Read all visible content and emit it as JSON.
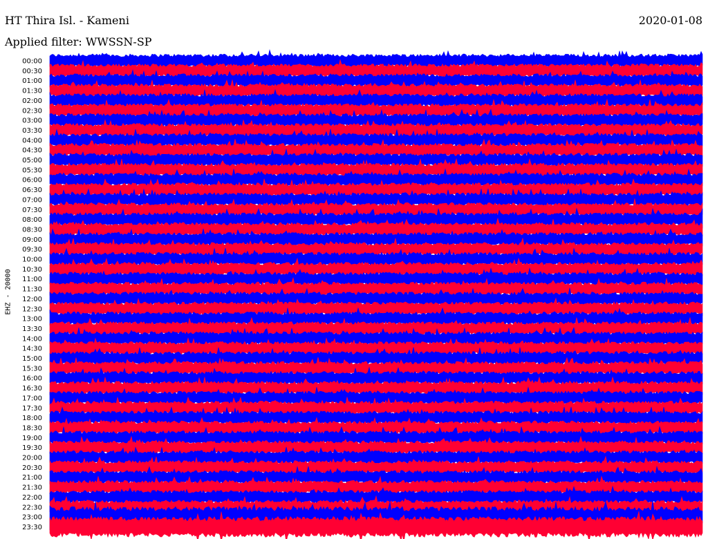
{
  "header": {
    "station": "HT Thira Isl. - Kameni",
    "date": "2020-01-08",
    "filter": "Applied filter: WWSSN-SP"
  },
  "channel_label": "EHZ - 20000",
  "colors": {
    "even_trace": "#0000ff",
    "odd_trace": "#ff0033",
    "background": "#ffffff"
  },
  "chart_data": {
    "type": "line",
    "title": "HT Thira Isl. - Kameni",
    "subtitle": "Applied filter: WWSSN-SP",
    "date": "2020-01-08",
    "ylabel": "EHZ - 20000",
    "y_tick_labels": [
      "00:00",
      "00:30",
      "01:00",
      "01:30",
      "02:00",
      "02:30",
      "03:00",
      "03:30",
      "04:00",
      "04:30",
      "05:00",
      "05:30",
      "06:00",
      "06:30",
      "07:00",
      "07:30",
      "08:00",
      "08:30",
      "09:00",
      "09:30",
      "10:00",
      "10:30",
      "11:00",
      "11:30",
      "12:00",
      "12:30",
      "13:00",
      "13:30",
      "14:00",
      "14:30",
      "15:00",
      "15:30",
      "16:00",
      "16:30",
      "17:00",
      "17:30",
      "18:00",
      "18:30",
      "19:00",
      "19:30",
      "20:00",
      "20:30",
      "21:00",
      "21:30",
      "22:00",
      "22:30",
      "23:00",
      "23:30"
    ],
    "trace_colors": [
      "#0000ff",
      "#ff0033"
    ],
    "row_minutes": 30,
    "grid": false,
    "legend": "none"
  }
}
